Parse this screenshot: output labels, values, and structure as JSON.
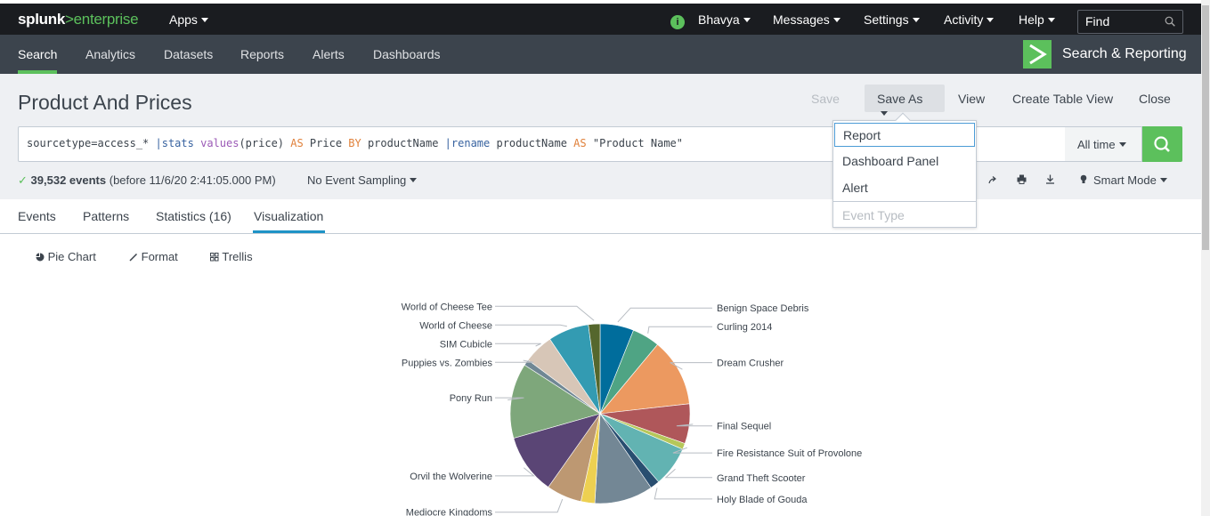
{
  "brand": {
    "splunk": "splunk",
    "sep": ">",
    "product": "enterprise"
  },
  "topbar": {
    "apps": "Apps",
    "info_icon": "i",
    "user": "Bhavya",
    "messages": "Messages",
    "settings": "Settings",
    "activity": "Activity",
    "help": "Help",
    "find_placeholder": "Find"
  },
  "appnav": {
    "items": [
      "Search",
      "Analytics",
      "Datasets",
      "Reports",
      "Alerts",
      "Dashboards"
    ],
    "app_name": "Search & Reporting"
  },
  "page": {
    "title": "Product And Prices",
    "save": "Save",
    "save_as": "Save As",
    "view": "View",
    "create_table_view": "Create Table View",
    "close": "Close"
  },
  "search": {
    "q1": "sourcetype=access_* ",
    "q2": "|",
    "q3": "stats",
    "q4": " ",
    "q5": "values",
    "q6": "(price) ",
    "q7": "AS",
    "q8": " Price ",
    "q9": "BY",
    "q10": " productName ",
    "q11": "|",
    "q12": "rename",
    "q13": " productName ",
    "q14": "AS",
    "q15": " \"Product Name\"",
    "time_range": "All time"
  },
  "results": {
    "check": "✓",
    "count": "39,532 events",
    "detail": "(before 11/6/20 2:41:05.000 PM)",
    "sampling": "No Event Sampling",
    "mode": "Smart Mode"
  },
  "tabs": [
    "Events",
    "Patterns",
    "Statistics (16)",
    "Visualization"
  ],
  "viz": {
    "pie": "Pie Chart",
    "format": "Format",
    "trellis": "Trellis"
  },
  "save_as_menu": {
    "items": [
      "Report",
      "Dashboard Panel",
      "Alert",
      "Event Type"
    ]
  },
  "chart_data": {
    "type": "pie",
    "slices": [
      {
        "label": "Benign Space Debris",
        "value": 6.1,
        "color": "#006d9c"
      },
      {
        "label": "Curling 2014",
        "value": 5.0,
        "color": "#4fa484"
      },
      {
        "label": "Dream Crusher",
        "value": 12.3,
        "color": "#ec9960"
      },
      {
        "label": "Final Sequel",
        "value": 7.2,
        "color": "#af575a"
      },
      {
        "label": "Fire Resistance Suit of Provolone",
        "value": 1.1,
        "color": "#b6c75a"
      },
      {
        "label": "Grand Theft Scooter",
        "value": 7.3,
        "color": "#62b3b2"
      },
      {
        "label": "Holy Blade of Gouda",
        "value": 1.7,
        "color": "#294e70"
      },
      {
        "label": "",
        "value": 10.6,
        "color": "#738795"
      },
      {
        "label": "",
        "value": 2.5,
        "color": "#edd051"
      },
      {
        "label": "Mediocre Kingdoms",
        "value": 6.4,
        "color": "#bd9872"
      },
      {
        "label": "Orvil the Wolverine",
        "value": 10.9,
        "color": "#5a4575"
      },
      {
        "label": "Pony Run",
        "value": 13.6,
        "color": "#7ea77b"
      },
      {
        "label": "Puppies vs. Zombies",
        "value": 1.1,
        "color": "#708794"
      },
      {
        "label": "SIM Cubicle",
        "value": 5.4,
        "color": "#d7c6b7"
      },
      {
        "label": "World of Cheese",
        "value": 7.4,
        "color": "#339bb2"
      },
      {
        "label": "World of Cheese Tee",
        "value": 2.1,
        "color": "#55672d"
      }
    ]
  }
}
